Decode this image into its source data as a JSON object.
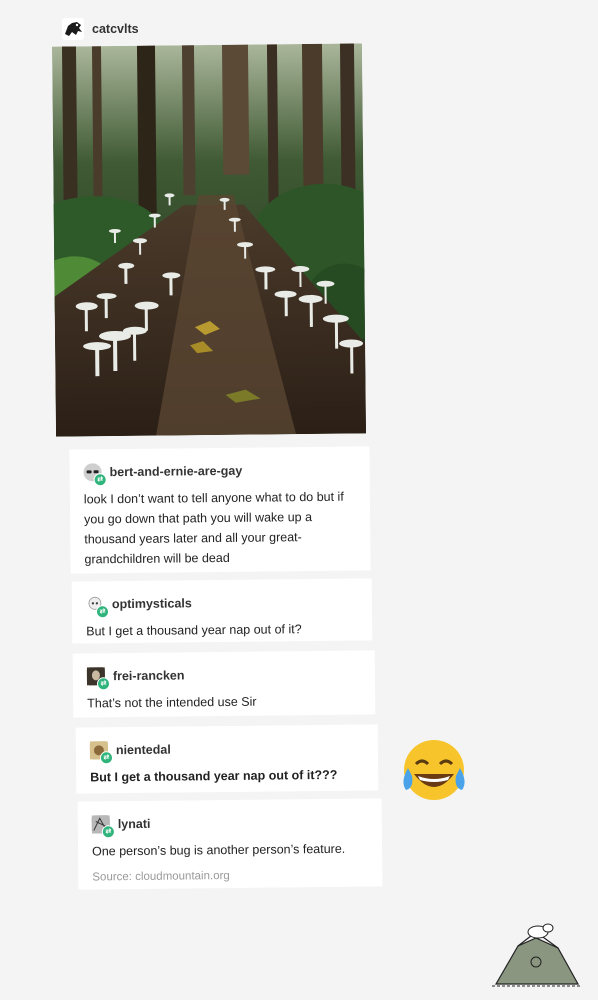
{
  "post": {
    "op_username": "catcvlts",
    "op_avatar_icon": "animal-avatar-icon"
  },
  "photo": {
    "description_icon": "forest-path-mushrooms-image"
  },
  "replies": [
    {
      "username": "bert-and-ernie-are-gay",
      "text": "look I don’t want to tell anyone what to do but if you go down that path you will wake up a thousand years later and all your great-grandchildren will be dead",
      "bold": false
    },
    {
      "username": "optimysticals",
      "text": "But I get a thousand year nap out of it?",
      "bold": false
    },
    {
      "username": "frei-rancken",
      "text": "That’s not the intended use Sir",
      "bold": false
    },
    {
      "username": "nientedal",
      "text": "But I get a thousand year nap out of it???",
      "bold": true
    },
    {
      "username": "lynati",
      "text": "One person’s bug is another person’s feature.",
      "bold": false
    }
  ],
  "source": "Source: cloudmountain.org",
  "decor": {
    "emoji_icon": "laughing-tears-emoji-icon",
    "sticker_icon": "snoopy-doghouse-sticker-icon"
  },
  "colors": {
    "reblog_badge": "#2fb47c",
    "background": "#f4f4f4"
  }
}
